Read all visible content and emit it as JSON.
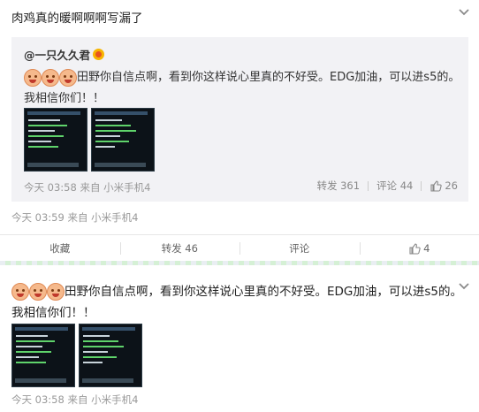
{
  "post_top": {
    "main_text": "肉鸡真的暖啊啊啊写漏了",
    "repost": {
      "username": "@一只久久君",
      "text": "田野你自信点啊，看到你这样说心里真的不好受。EDG加油，可以进s5的。我相信你们！！",
      "meta": "今天 03:58 来自 小米手机4",
      "repost_count_label": "转发 361",
      "comment_count_label": "评论 44",
      "like_count": "26"
    },
    "meta": "今天 03:59 来自 小米手机4",
    "actions": {
      "favorite": "收藏",
      "repost": "转发 46",
      "comment": "评论",
      "like": "4"
    }
  },
  "post_bottom": {
    "text": "田野你自信点啊，看到你这样说心里真的不好受。EDG加油，可以进s5的。我相信你们！！",
    "meta": "今天 03:58 来自 小米手机4"
  },
  "icons": {
    "expand": "chevron-down-icon",
    "like": "thumbs-up-icon",
    "vip": "vip-badge-icon",
    "emoji": "face-emoji-icon"
  },
  "colors": {
    "repost_bg": "#f2f2f5",
    "meta_text": "#999999",
    "text": "#333333"
  }
}
